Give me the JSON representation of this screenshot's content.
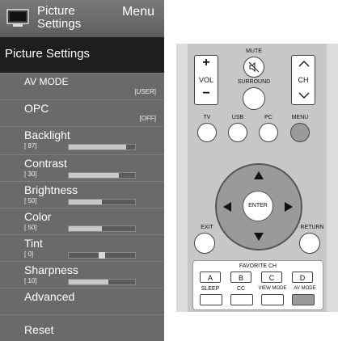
{
  "menu": {
    "header_title": "Picture\nSettings",
    "header_right": "Menu",
    "section_title": "Picture Settings",
    "items": [
      {
        "label": "AV MODE",
        "value": "[USER]"
      },
      {
        "label": "OPC",
        "value": "[OFF]"
      },
      {
        "label": "Backlight",
        "num": "[ 87]",
        "level": 0.87
      },
      {
        "label": "Contrast",
        "num": "[ 30]",
        "level": 0.75
      },
      {
        "label": "Brightness",
        "num": "[ 50]",
        "level": 0.5
      },
      {
        "label": "Color",
        "num": "[ 50]",
        "level": 0.5
      },
      {
        "label": "Tint",
        "num": "[  0]",
        "level": 0.5
      },
      {
        "label": "Sharpness",
        "num": "[ 10]",
        "level": 0.6
      },
      {
        "label": "Advanced"
      },
      {
        "label": "Reset"
      }
    ]
  },
  "remote": {
    "mute": "MUTE",
    "vol": "VOL",
    "surround": "SURROUND",
    "ch": "CH",
    "tv": "TV",
    "usb": "USB",
    "pc": "PC",
    "menu": "MENU",
    "enter": "ENTER",
    "exit": "EXIT",
    "return": "RETURN",
    "favorite": "FAVORITE CH",
    "fav_buttons": [
      "A",
      "B",
      "C",
      "D"
    ],
    "sleep": "SLEEP",
    "cc": "CC",
    "view_mode": "VIEW MODE",
    "av_mode": "AV MODE"
  }
}
